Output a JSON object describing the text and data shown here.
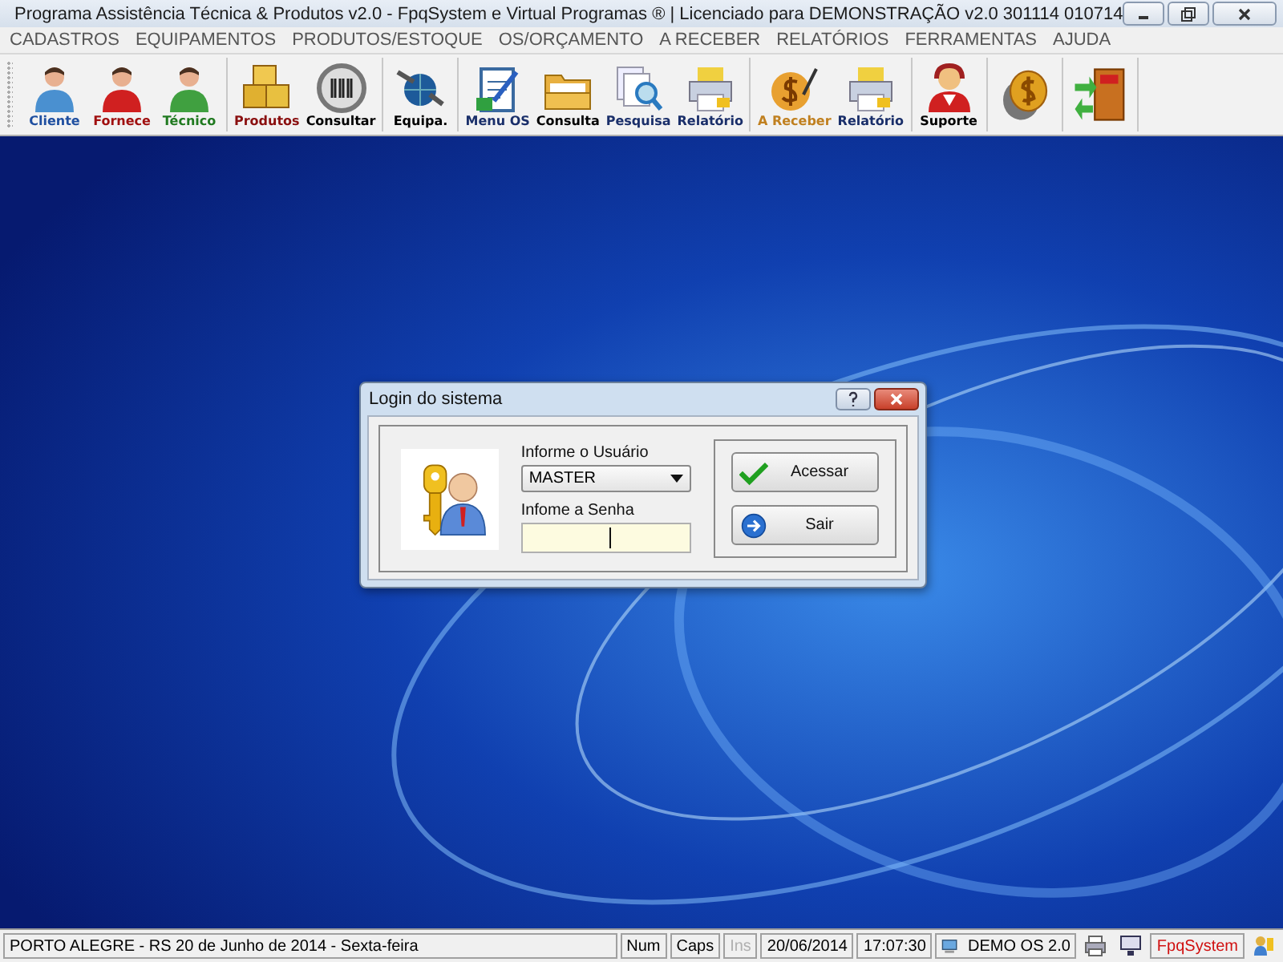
{
  "window": {
    "title": "Programa Assistência Técnica & Produtos v2.0 - FpqSystem e Virtual Programas ® | Licenciado para  DEMONSTRAÇÃO v2.0 301114 010714"
  },
  "menu": [
    "CADASTROS",
    "EQUIPAMENTOS",
    "PRODUTOS/ESTOQUE",
    "OS/ORÇAMENTO",
    "A RECEBER",
    "RELATÓRIOS",
    "FERRAMENTAS",
    "AJUDA"
  ],
  "toolbar": [
    {
      "items": [
        {
          "label": "Cliente",
          "color": "#1f4fa0"
        },
        {
          "label": "Fornece",
          "color": "#a01010"
        },
        {
          "label": "Técnico",
          "color": "#207a20"
        }
      ]
    },
    {
      "items": [
        {
          "label": "Produtos",
          "color": "#8a1010"
        },
        {
          "label": "Consultar",
          "color": "#000000"
        }
      ]
    },
    {
      "items": [
        {
          "label": "Equipa.",
          "color": "#000000"
        }
      ]
    },
    {
      "items": [
        {
          "label": "Menu OS",
          "color": "#1a2f6a"
        },
        {
          "label": "Consulta",
          "color": "#000000"
        },
        {
          "label": "Pesquisa",
          "color": "#1a2f6a"
        },
        {
          "label": "Relatório",
          "color": "#1a2f6a"
        }
      ]
    },
    {
      "items": [
        {
          "label": "A Receber",
          "color": "#c08020"
        },
        {
          "label": "Relatório",
          "color": "#1a2f6a"
        }
      ]
    },
    {
      "items": [
        {
          "label": "Suporte",
          "color": "#000000"
        }
      ]
    },
    {
      "items": [
        {
          "kind": "icon_only"
        }
      ]
    },
    {
      "items": [
        {
          "kind": "icon_only"
        }
      ]
    }
  ],
  "dialog": {
    "title": "Login do sistema",
    "user_label": "Informe o Usuário",
    "user_value": "MASTER",
    "password_label": "Infome a Senha",
    "buttons": [
      "Acessar",
      "Sair"
    ]
  },
  "status_bar": [
    {
      "kind": "text",
      "text": "PORTO ALEGRE - RS 20 de Junho de 2014 - Sexta-feira",
      "disabled": false,
      "color": "#000000"
    },
    {
      "kind": "text",
      "text": "Num",
      "disabled": false,
      "color": "#000000"
    },
    {
      "kind": "text",
      "text": "Caps",
      "disabled": false,
      "color": "#000000"
    },
    {
      "kind": "text",
      "text": "Ins",
      "disabled": true
    },
    {
      "kind": "text",
      "text": "20/06/2014",
      "disabled": false,
      "color": "#000000"
    },
    {
      "kind": "text",
      "text": "17:07:30",
      "disabled": false,
      "color": "#000000"
    },
    {
      "kind": "icon_text",
      "text": "DEMO OS 2.0"
    },
    {
      "kind": "icon"
    },
    {
      "kind": "icon"
    },
    {
      "kind": "text",
      "text": "FpqSystem",
      "disabled": false,
      "color": "#d01010"
    },
    {
      "kind": "icon"
    }
  ]
}
